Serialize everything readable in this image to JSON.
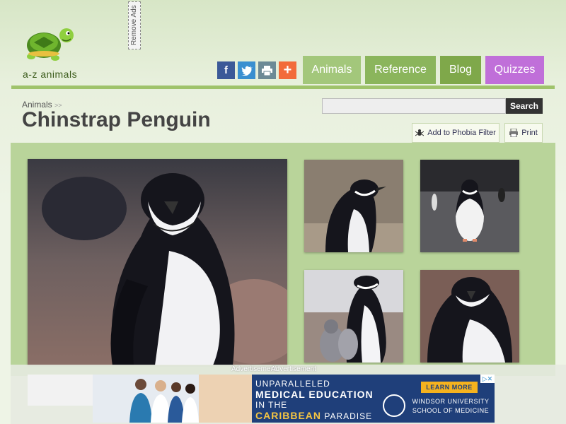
{
  "site": {
    "logo_text": "a-z animals",
    "remove_ads": "Remove Ads"
  },
  "share": [
    {
      "icon": "facebook-icon",
      "glyph": "f"
    },
    {
      "icon": "twitter-icon",
      "glyph": "🐦"
    },
    {
      "icon": "print-icon",
      "glyph": "⎙"
    },
    {
      "icon": "plus-icon",
      "glyph": "+"
    }
  ],
  "nav": {
    "animals": "Animals",
    "reference": "Reference",
    "blog": "Blog",
    "quizzes": "Quizzes"
  },
  "breadcrumb": {
    "root": "Animals",
    "sep": ">>"
  },
  "page": {
    "title": "Chinstrap Penguin"
  },
  "search": {
    "value": "",
    "button": "Search"
  },
  "actions": {
    "phobia": "Add to Phobia Filter",
    "print": "Print"
  },
  "ads": {
    "label": "Advertisement",
    "headline_l1": "UNPARALLELED",
    "headline_l2": "MEDICAL EDUCATION",
    "headline_l3": "IN THE",
    "headline_l4a": "CARIBBEAN",
    "headline_l4b": "PARADISE",
    "cta": "LEARN MORE",
    "uni_l1": "WINDSOR UNIVERSITY",
    "uni_l2": "SCHOOL OF MEDICINE",
    "close": "▷✕"
  },
  "colors": {
    "nav_animals": "#a3c77b",
    "nav_reference": "#8bb55c",
    "nav_blog": "#7fa84a",
    "nav_quizzes": "#c06fd9",
    "accent_bar": "#9fc36b"
  }
}
